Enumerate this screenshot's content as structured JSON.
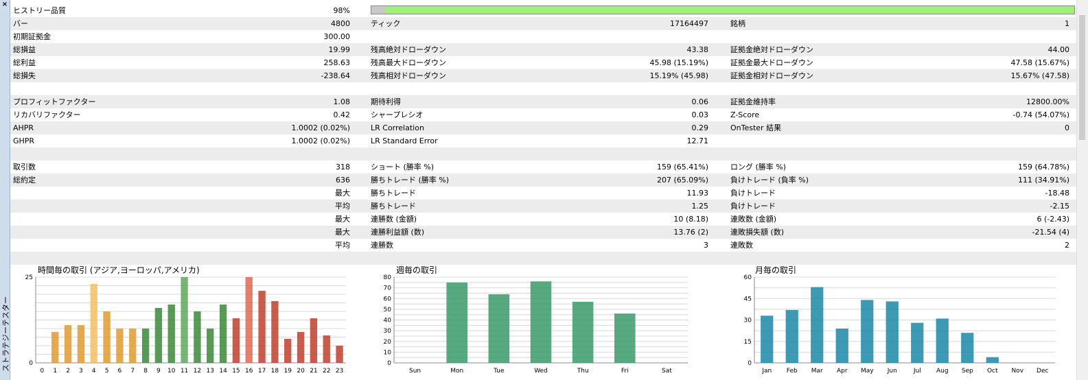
{
  "sidebar": {
    "close_label": "×",
    "title": "ストラテジーテスター"
  },
  "quality": {
    "label": "ヒストリー品質",
    "value": "98%",
    "fraction": 0.98
  },
  "rows": [
    {
      "shade": true,
      "l1": "バー",
      "v1": "4800",
      "l2": "ティック",
      "v2": "17164497",
      "l3": "銘柄",
      "v3": "1"
    },
    {
      "shade": false,
      "l1": "初期証拠金",
      "v1": "300.00",
      "l2": "",
      "v2": "",
      "l3": "",
      "v3": ""
    },
    {
      "shade": true,
      "l1": "総損益",
      "v1": "19.99",
      "l2": "残高絶対ドローダウン",
      "v2": "43.38",
      "l3": "証拠金絶対ドローダウン",
      "v3": "44.00"
    },
    {
      "shade": false,
      "l1": "総利益",
      "v1": "258.63",
      "l2": "残高最大ドローダウン",
      "v2": "45.98 (15.19%)",
      "l3": "証拠金最大ドローダウン",
      "v3": "47.58 (15.67%)"
    },
    {
      "shade": true,
      "l1": "総損失",
      "v1": "-238.64",
      "l2": "残高相対ドローダウン",
      "v2": "15.19% (45.98)",
      "l3": "証拠金相対ドローダウン",
      "v3": "15.67% (47.58)"
    },
    {
      "shade": false,
      "l1": "",
      "v1": "",
      "l2": "",
      "v2": "",
      "l3": "",
      "v3": ""
    },
    {
      "shade": true,
      "l1": "プロフィットファクター",
      "v1": "1.08",
      "l2": "期待利得",
      "v2": "0.06",
      "l3": "証拠金維持率",
      "v3": "12800.00%"
    },
    {
      "shade": false,
      "l1": "リカバリファクター",
      "v1": "0.42",
      "l2": "シャープレシオ",
      "v2": "0.03",
      "l3": "Z-Score",
      "v3": "-0.74 (54.07%)"
    },
    {
      "shade": true,
      "l1": "AHPR",
      "v1": "1.0002 (0.02%)",
      "l2": "LR Correlation",
      "v2": "0.29",
      "l3": "OnTester 結果",
      "v3": "0"
    },
    {
      "shade": false,
      "l1": "GHPR",
      "v1": "1.0002 (0.02%)",
      "l2": "LR Standard Error",
      "v2": "12.71",
      "l3": "",
      "v3": ""
    },
    {
      "shade": true,
      "l1": "",
      "v1": "",
      "l2": "",
      "v2": "",
      "l3": "",
      "v3": ""
    },
    {
      "shade": false,
      "l1": "取引数",
      "v1": "318",
      "l2": "ショート (勝率 %)",
      "v2": "159 (65.41%)",
      "l3": "ロング (勝率 %)",
      "v3": "159 (64.78%)"
    },
    {
      "shade": true,
      "l1": "総約定",
      "v1": "636",
      "l2": "勝ちトレード (勝率 %)",
      "v2": "207 (65.09%)",
      "l3": "負けトレード (負率 %)",
      "v3": "111 (34.91%)"
    },
    {
      "shade": false,
      "l1": "",
      "v1": "最大",
      "l2": "勝ちトレード",
      "v2": "11.93",
      "l3": "負けトレード",
      "v3": "-18.48"
    },
    {
      "shade": true,
      "l1": "",
      "v1": "平均",
      "l2": "勝ちトレード",
      "v2": "1.25",
      "l3": "負けトレード",
      "v3": "-2.15"
    },
    {
      "shade": false,
      "l1": "",
      "v1": "最大",
      "l2": "連勝数 (金額)",
      "v2": "10 (8.18)",
      "l3": "連敗数 (金額)",
      "v3": "6 (-2.43)"
    },
    {
      "shade": true,
      "l1": "",
      "v1": "最大",
      "l2": "連勝利益額 (数)",
      "v2": "13.76 (2)",
      "l3": "連敗損失額 (数)",
      "v3": "-21.54 (4)"
    },
    {
      "shade": false,
      "l1": "",
      "v1": "平均",
      "l2": "連勝数",
      "v2": "3",
      "l3": "連敗数",
      "v3": "2"
    },
    {
      "shade": true,
      "l1": "",
      "v1": "",
      "l2": "",
      "v2": "",
      "l3": "",
      "v3": ""
    }
  ],
  "chart_data": [
    {
      "type": "bar",
      "title": "時間毎の取引 (アジア,ヨーロッパ,アメリカ)",
      "categories": [
        "0",
        "1",
        "2",
        "3",
        "4",
        "5",
        "6",
        "7",
        "8",
        "9",
        "10",
        "11",
        "12",
        "13",
        "14",
        "15",
        "16",
        "17",
        "18",
        "19",
        "20",
        "21",
        "22",
        "23"
      ],
      "values": [
        0,
        9,
        11,
        11,
        23,
        15,
        10,
        10,
        10,
        16,
        17,
        25,
        15,
        10,
        17,
        13,
        25,
        21,
        18,
        7,
        9,
        13,
        8,
        5
      ],
      "ylim": [
        0,
        25
      ],
      "yticks": [
        0,
        25
      ],
      "colors": [
        "#e09a30",
        "#e09a30",
        "#e09a30",
        "#e09a30",
        "#f5c060",
        "#e09a30",
        "#e09a30",
        "#e09a30",
        "#3a8a3a",
        "#3a8a3a",
        "#3a8a3a",
        "#5aaa5a",
        "#3a8a3a",
        "#3a8a3a",
        "#3a8a3a",
        "#c0402a",
        "#e06850",
        "#c0402a",
        "#c0402a",
        "#c0402a",
        "#c0402a",
        "#c0402a",
        "#c0402a",
        "#c0402a"
      ]
    },
    {
      "type": "bar",
      "title": "週毎の取引",
      "categories": [
        "Sun",
        "Mon",
        "Tue",
        "Wed",
        "Thu",
        "Fri",
        "Sat"
      ],
      "values": [
        0,
        75,
        64,
        76,
        57,
        46,
        0
      ],
      "ylim": [
        0,
        80
      ],
      "yticks": [
        0,
        10,
        20,
        30,
        40,
        50,
        60,
        70,
        80
      ],
      "color": "#3a9a68"
    },
    {
      "type": "bar",
      "title": "月毎の取引",
      "categories": [
        "Jan",
        "Feb",
        "Mar",
        "Apr",
        "May",
        "Jun",
        "Jul",
        "Aug",
        "Sep",
        "Oct",
        "Nov",
        "Dec"
      ],
      "values": [
        33,
        37,
        53,
        24,
        44,
        43,
        28,
        31,
        21,
        4,
        0,
        0
      ],
      "ylim": [
        0,
        60
      ],
      "yticks": [
        0,
        15,
        30,
        45,
        60
      ],
      "color": "#1a88a8"
    }
  ]
}
